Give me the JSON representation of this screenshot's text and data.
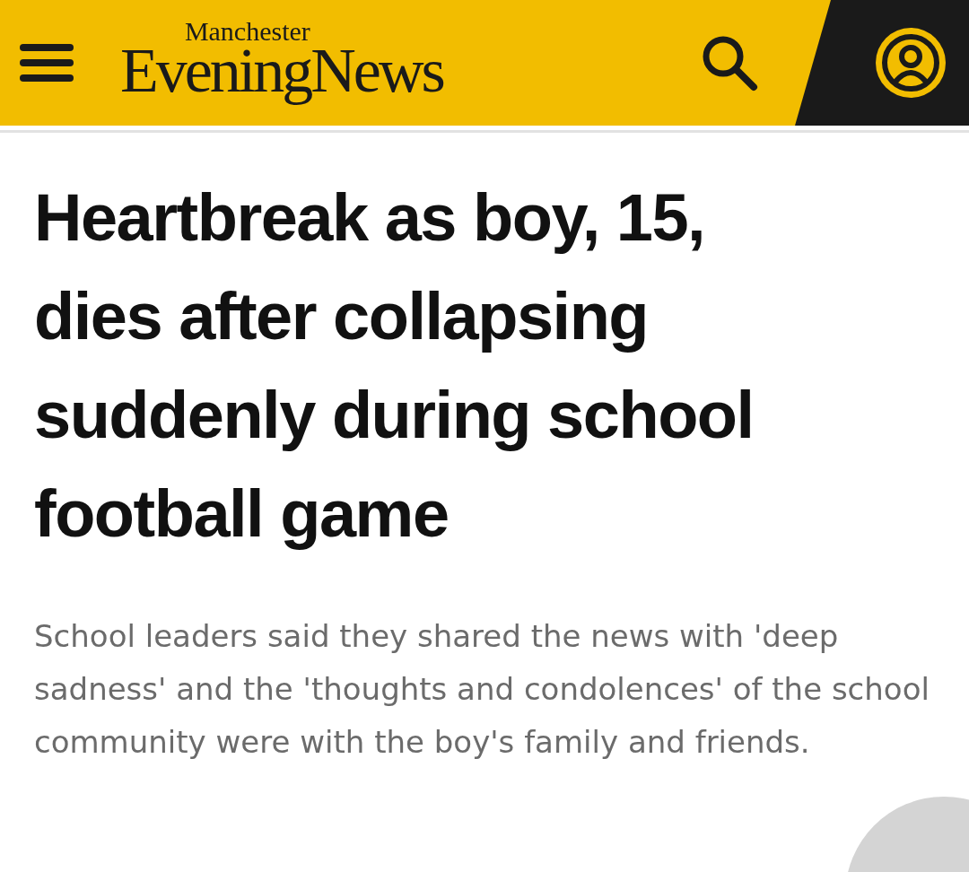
{
  "header": {
    "logo_top": "Manchester",
    "logo_main": "EveningNews"
  },
  "article": {
    "headline": "Heartbreak as boy, 15, dies after collapsing suddenly during school football game",
    "standfirst": "School leaders said they shared the news with 'deep sadness' and the 'thoughts and condolences' of the school community were with the boy's family and friends."
  }
}
